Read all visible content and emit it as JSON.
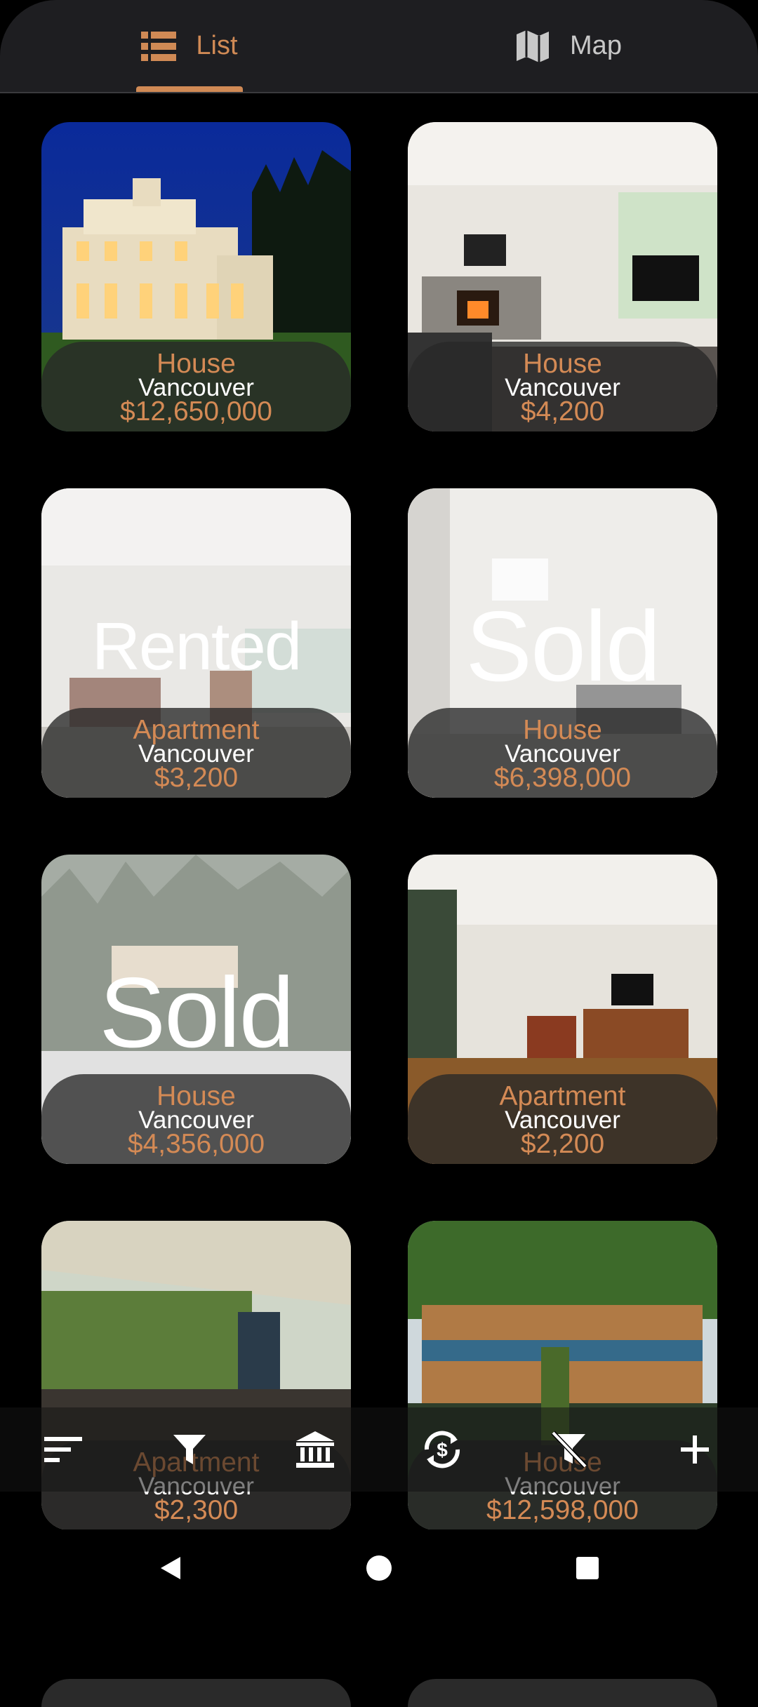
{
  "tabs": [
    {
      "label": "List",
      "icon": "list-icon",
      "active": true
    },
    {
      "label": "Map",
      "icon": "map-icon",
      "active": false
    }
  ],
  "listings": [
    {
      "type": "House",
      "city": "Vancouver",
      "price": "$12,650,000",
      "status": ""
    },
    {
      "type": "House",
      "city": "Vancouver",
      "price": "$4,200",
      "status": ""
    },
    {
      "type": "Apartment",
      "city": "Vancouver",
      "price": "$3,200",
      "status": "Rented"
    },
    {
      "type": "House",
      "city": "Vancouver",
      "price": "$6,398,000",
      "status": "Sold"
    },
    {
      "type": "House",
      "city": "Vancouver",
      "price": "$4,356,000",
      "status": "Sold"
    },
    {
      "type": "Apartment",
      "city": "Vancouver",
      "price": "$2,200",
      "status": ""
    },
    {
      "type": "Apartment",
      "city": "Vancouver",
      "price": "$2,300",
      "status": ""
    },
    {
      "type": "House",
      "city": "Vancouver",
      "price": "$12,598,000",
      "status": ""
    }
  ],
  "bottom_actions": [
    {
      "icon": "sort-icon"
    },
    {
      "icon": "filter-icon"
    },
    {
      "icon": "bank-icon"
    },
    {
      "icon": "currency-convert-icon"
    },
    {
      "icon": "clear-filter-icon"
    },
    {
      "icon": "add-icon"
    }
  ],
  "colors": {
    "accent": "#d48a55",
    "topbar": "#1e1e21",
    "background": "#000000"
  }
}
